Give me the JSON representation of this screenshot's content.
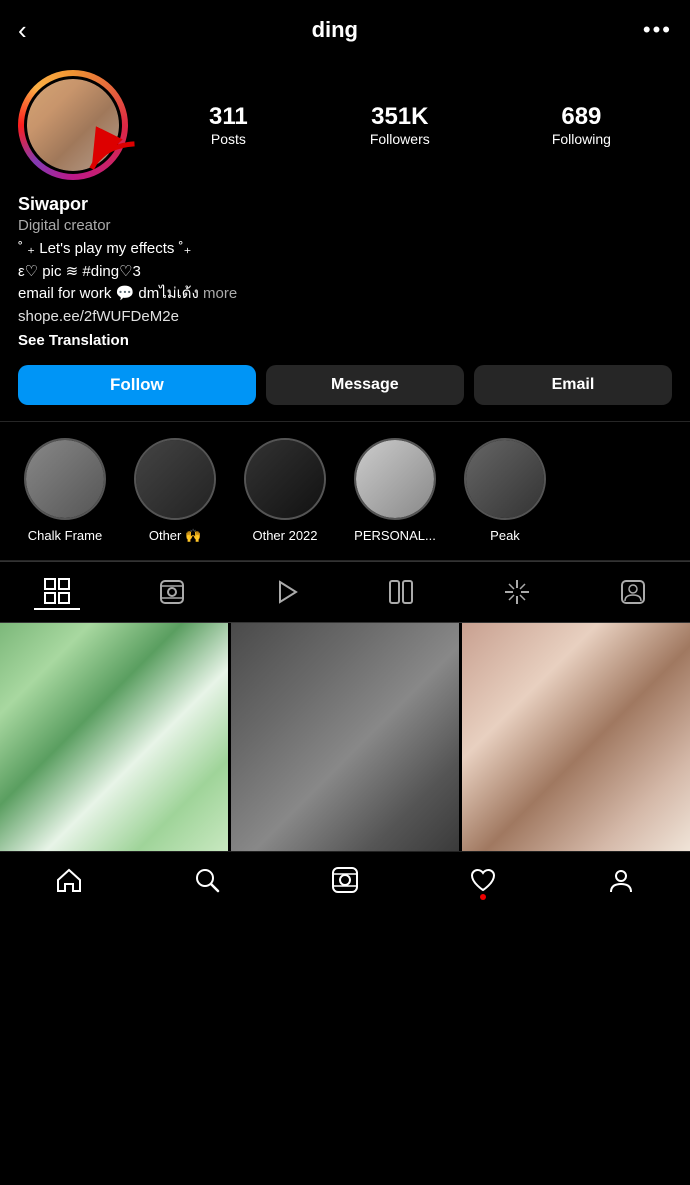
{
  "header": {
    "back_label": "‹",
    "username": "ding",
    "more_label": "•••"
  },
  "profile": {
    "name": "Siwapor",
    "subtitle": "Digital creator",
    "bio_line1": "˚ ₊ Let's play my effects ˚₊",
    "bio_line2": "ε♡ pic ≋ #ding♡3",
    "bio_line3": "email for work 💬 dmไม่เด้ง",
    "bio_more": "more",
    "bio_link": "shope.ee/2fWUFDeM2e",
    "see_translation": "See Translation",
    "stats": {
      "posts_num": "311",
      "posts_label": "Posts",
      "followers_num": "351K",
      "followers_label": "Followers",
      "following_num": "689",
      "following_label": "Following"
    }
  },
  "buttons": {
    "follow": "Follow",
    "message": "Message",
    "email": "Email"
  },
  "highlights": [
    {
      "label": "Chalk Frame",
      "thumb_class": "hl-1"
    },
    {
      "label": "Other 🙌",
      "thumb_class": "hl-2"
    },
    {
      "label": "Other 2022",
      "thumb_class": "hl-3"
    },
    {
      "label": "PERSONAL...",
      "thumb_class": "hl-4"
    },
    {
      "label": "Peak",
      "thumb_class": "hl-5"
    }
  ],
  "tabs": [
    {
      "id": "grid",
      "label": "Grid",
      "active": true
    },
    {
      "id": "reels",
      "label": "Reels",
      "active": false
    },
    {
      "id": "video",
      "label": "Video",
      "active": false
    },
    {
      "id": "guide",
      "label": "Guide",
      "active": false
    },
    {
      "id": "tagged",
      "label": "Tagged",
      "active": false
    },
    {
      "id": "collab",
      "label": "Collab",
      "active": false
    }
  ],
  "colors": {
    "follow_blue": "#0095f6",
    "bg": "#000000",
    "accent_red": "#e00000"
  }
}
